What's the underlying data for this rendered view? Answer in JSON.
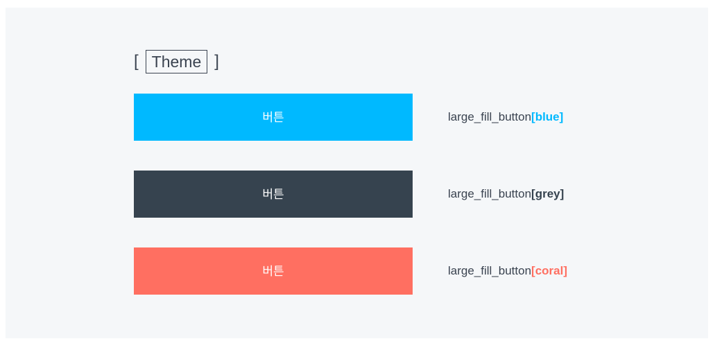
{
  "heading": {
    "open_bracket": "[",
    "title": "Theme",
    "close_bracket": "]"
  },
  "buttons": [
    {
      "label": "버튼",
      "component_name": "large_fill_button",
      "variant": "[blue]",
      "color": "#00b9ff"
    },
    {
      "label": "버튼",
      "component_name": "large_fill_button",
      "variant": "[grey]",
      "color": "#36434f"
    },
    {
      "label": "버튼",
      "component_name": "large_fill_button",
      "variant": "[coral]",
      "color": "#ff6f61"
    }
  ],
  "colors": {
    "background": "#f5f7f9",
    "text": "#3a4350"
  }
}
